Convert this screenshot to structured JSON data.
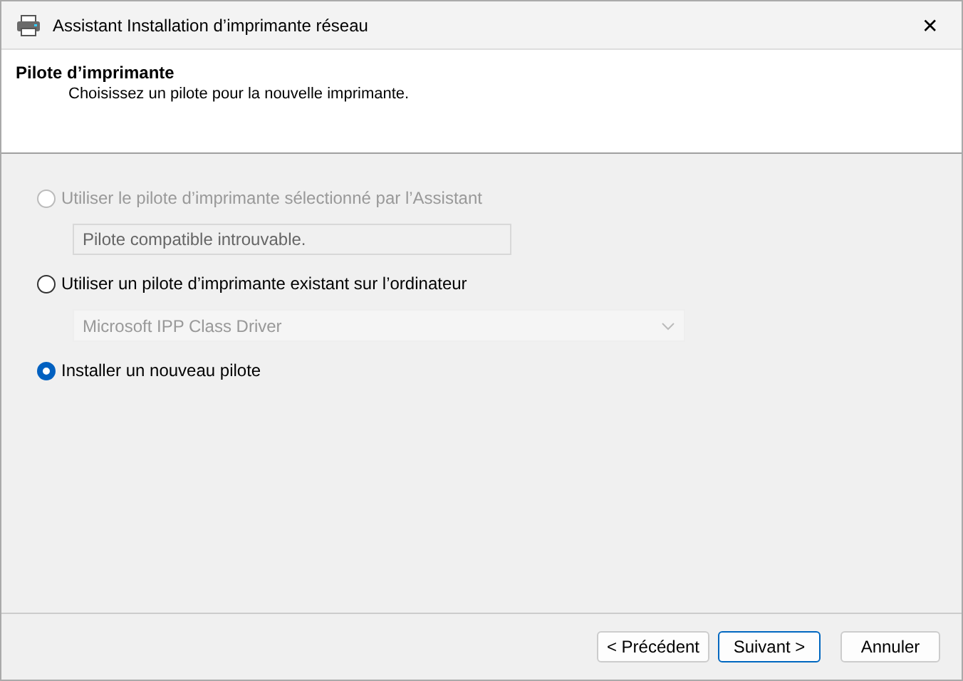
{
  "window": {
    "title": "Assistant Installation d’imprimante réseau",
    "close": "✕"
  },
  "header": {
    "title": "Pilote d’imprimante",
    "subtitle": "Choisissez un pilote pour la nouvelle imprimante."
  },
  "options": [
    {
      "label": "Utiliser le pilote d’imprimante sélectionné par l’Assistant",
      "selected": false,
      "disabled": true,
      "field": {
        "kind": "text",
        "value": "Pilote compatible introuvable.",
        "disabled": true
      }
    },
    {
      "label": "Utiliser un pilote d’imprimante existant sur l’ordinateur",
      "selected": false,
      "disabled": false,
      "field": {
        "kind": "dropdown",
        "value": "Microsoft IPP Class Driver",
        "disabled": true
      }
    },
    {
      "label": "Installer un nouveau pilote",
      "selected": true,
      "disabled": false
    }
  ],
  "buttons": [
    {
      "label": "< Précédent",
      "default": false
    },
    {
      "label": "Suivant >",
      "default": true
    },
    {
      "label": "Annuler",
      "default": false
    }
  ]
}
